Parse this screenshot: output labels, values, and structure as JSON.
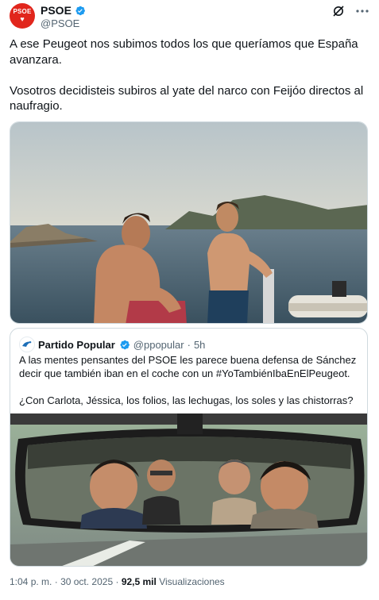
{
  "tweet": {
    "author_name": "PSOE",
    "author_handle": "@PSOE",
    "avatar_text": "PSOE",
    "text": "A ese Peugeot nos subimos todos los que queríamos que España avanzara.\n\nVosotros decidisteis subiros al yate del narco con Feijóo directos al naufragio."
  },
  "quoted": {
    "author_name": "Partido Popular",
    "author_handle": "@ppopular",
    "separator": "·",
    "time": "5h",
    "text": "A las mentes pensantes del PSOE les parece buena defensa de Sánchez decir que también iban en el coche con un #YoTambiénIbaEnElPeugeot.\n\n¿Con Carlota, Jéssica, los folios, las lechugas, los soles y las chistorras?"
  },
  "footer": {
    "time": "1:04 p. m.",
    "dot1": "·",
    "date": "30 oct. 2025",
    "dot2": "·",
    "views_count": "92,5 mil",
    "views_label": "Visualizaciones"
  },
  "colors": {
    "verified_blue": "#1d9bf0",
    "psoe_red": "#e1261c",
    "text_primary": "#0f1419",
    "text_secondary": "#536471"
  },
  "icons": [
    "verified-badge-icon",
    "grok-icon",
    "more-icon",
    "pp-logo-icon"
  ]
}
